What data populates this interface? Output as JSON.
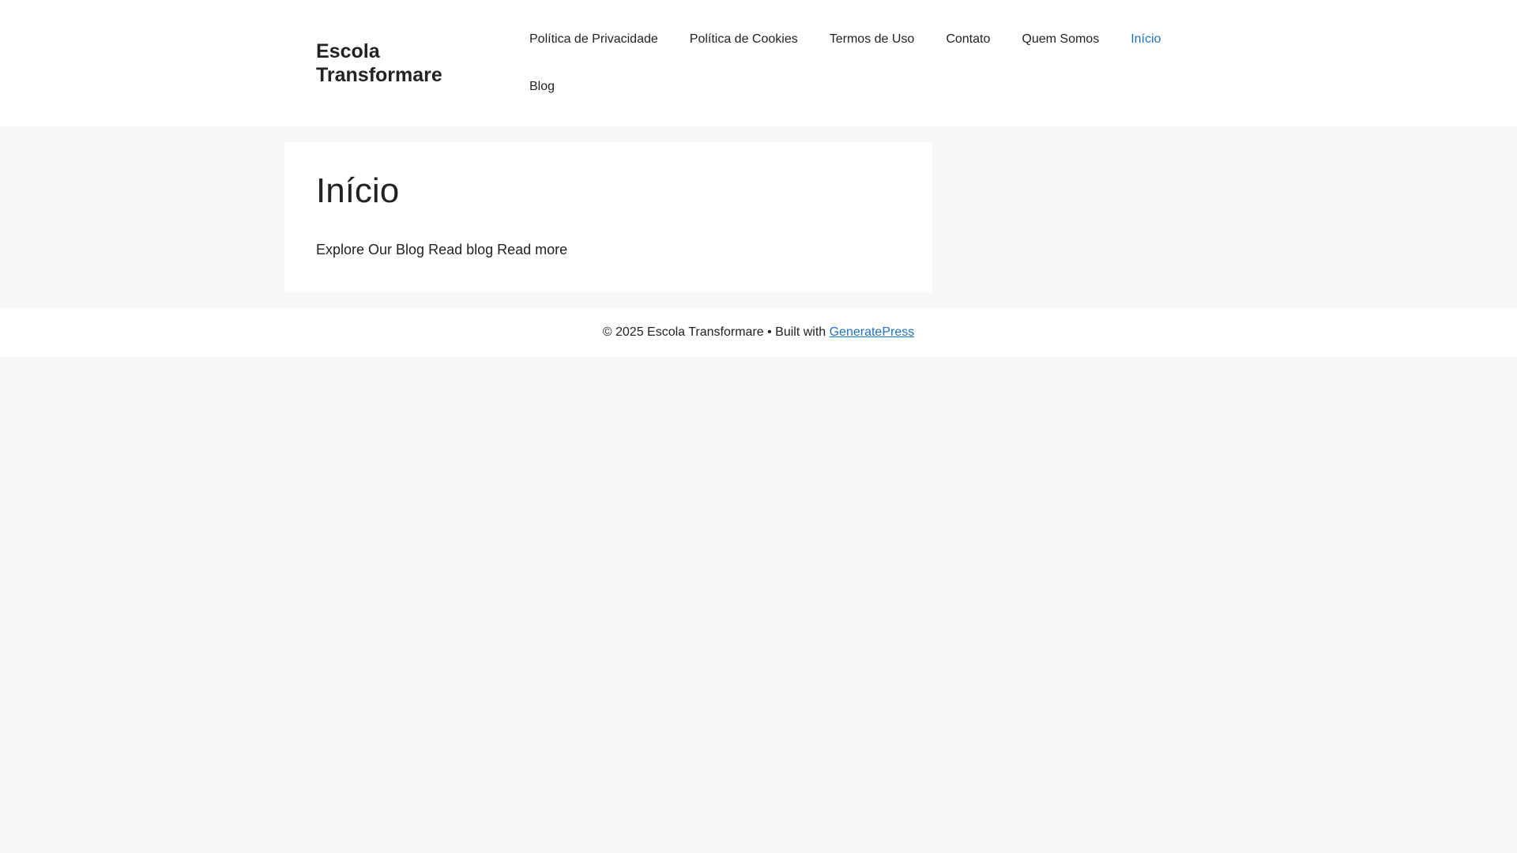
{
  "header": {
    "site_title": "Escola Transformare",
    "nav": {
      "items": [
        {
          "label": "Política de Privacidade"
        },
        {
          "label": "Política de Cookies"
        },
        {
          "label": "Termos de Uso"
        },
        {
          "label": "Contato"
        },
        {
          "label": "Quem Somos"
        },
        {
          "label": "Início"
        },
        {
          "label": "Blog"
        }
      ],
      "current_label": "Início"
    }
  },
  "main": {
    "title": "Início",
    "text": "Explore Our Blog Read blog Read more"
  },
  "footer": {
    "copyright": "© 2025 Escola Transformare • Built with ",
    "link_label": "GeneratePress"
  },
  "colors": {
    "page_background": "#f6f7f9",
    "surface": "#ffffff",
    "text": "#222222",
    "accent": "#1e73be"
  }
}
